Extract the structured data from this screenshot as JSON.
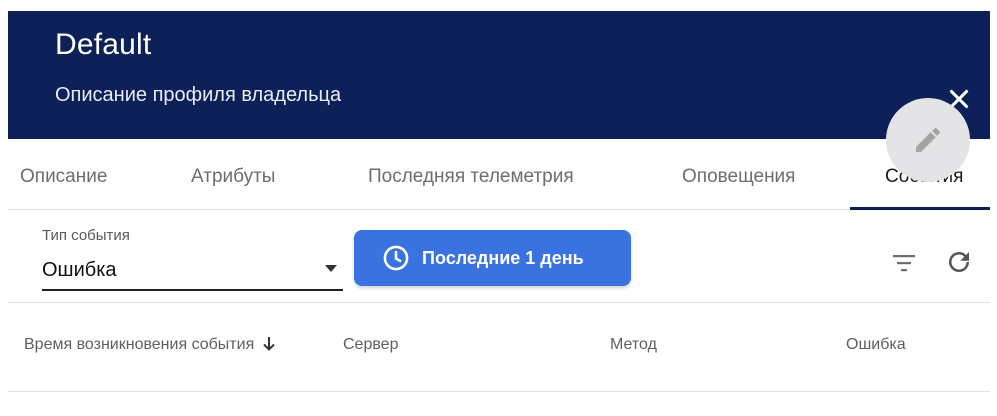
{
  "dialog": {
    "title": "Default",
    "subtitle": "Описание профиля владельца",
    "close_icon": "close-icon",
    "edit_icon": "pencil-icon"
  },
  "tabs": [
    {
      "label": "Описание",
      "active": false
    },
    {
      "label": "Атрибуты",
      "active": false
    },
    {
      "label": "Последняя телеметрия",
      "active": false
    },
    {
      "label": "Оповещения",
      "active": false
    },
    {
      "label": "События",
      "active": true
    }
  ],
  "toolbar": {
    "event_type_label": "Тип события",
    "event_type_value": "Ошибка",
    "time_button_label": "Последние 1 день",
    "time_icon": "clock-icon",
    "filter_icon": "filter-icon",
    "refresh_icon": "refresh-icon"
  },
  "table": {
    "columns": [
      {
        "label": "Время возникновения события",
        "sorted": "desc"
      },
      {
        "label": "Сервер"
      },
      {
        "label": "Метод"
      },
      {
        "label": "Ошибка"
      }
    ]
  },
  "colors": {
    "header_bg": "#0d2158",
    "accent_button": "#3a72e0",
    "fab_bg": "#e4e4e6"
  }
}
